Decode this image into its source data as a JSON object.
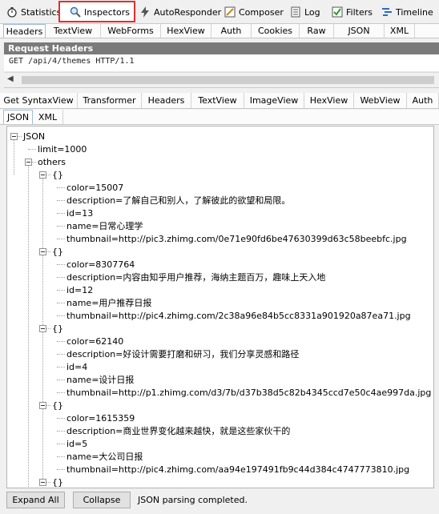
{
  "top_tabs": [
    {
      "label": "Statistics",
      "icon": "stopwatch-icon",
      "active": false
    },
    {
      "label": "Inspectors",
      "icon": "magnifier-icon",
      "active": true
    },
    {
      "label": "AutoResponder",
      "icon": "lightning-icon",
      "active": false
    },
    {
      "label": "Composer",
      "icon": "pencil-icon",
      "active": false
    },
    {
      "label": "Log",
      "icon": "log-icon",
      "active": false
    },
    {
      "label": "Filters",
      "icon": "checkbox-icon",
      "active": false
    },
    {
      "label": "Timeline",
      "icon": "timeline-icon",
      "active": false
    }
  ],
  "request_tabs": [
    "Headers",
    "TextView",
    "WebForms",
    "HexView",
    "Auth",
    "Cookies",
    "Raw",
    "JSON",
    "XML"
  ],
  "request_headers": {
    "title": "Request Headers",
    "request_line": "GET /api/4/themes HTTP/1.1"
  },
  "response_tabs": [
    "Get SyntaxView",
    "Transformer",
    "Headers",
    "TextView",
    "ImageView",
    "HexView",
    "WebView",
    "Auth"
  ],
  "json_tabs": [
    "JSON",
    "XML"
  ],
  "tree": {
    "root": "JSON",
    "limit": "limit=1000",
    "others": "others",
    "object_label": "{}",
    "items": [
      {
        "color": "color=15007",
        "description": "description=了解自己和别人，了解彼此的欲望和局限。",
        "id": "id=13",
        "name": "name=日常心理学",
        "thumbnail": "thumbnail=http://pic3.zhimg.com/0e71e90fd6be47630399d63c58beebfc.jpg"
      },
      {
        "color": "color=8307764",
        "description": "description=内容由知乎用户推荐，海纳主题百万，趣味上天入地",
        "id": "id=12",
        "name": "name=用户推荐日报",
        "thumbnail": "thumbnail=http://pic4.zhimg.com/2c38a96e84b5cc8331a901920a87ea71.jpg"
      },
      {
        "color": "color=62140",
        "description": "description=好设计需要打磨和研习，我们分享灵感和路径",
        "id": "id=4",
        "name": "name=设计日报",
        "thumbnail": "thumbnail=http://p1.zhimg.com/d3/7b/d37b38d5c82b4345ccd7e50c4ae997da.jpg"
      },
      {
        "color": "color=1615359",
        "description": "description=商业世界变化越来越快，就是这些家伙干的",
        "id": "id=5",
        "name": "name=大公司日报",
        "thumbnail": "thumbnail=http://pic4.zhimg.com/aa94e197491fb9c44d384c4747773810.jpg"
      }
    ]
  },
  "bottom": {
    "expand_all": "Expand All",
    "collapse": "Collapse",
    "status": "JSON parsing completed."
  },
  "colors": {
    "active_outline": "#e0302f",
    "header_bar": "#7a7a7a"
  }
}
